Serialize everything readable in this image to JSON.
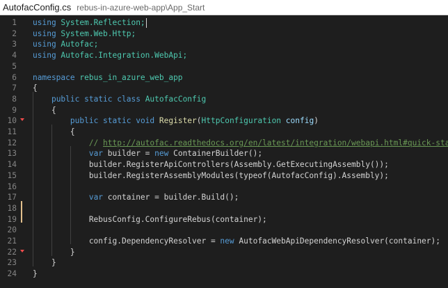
{
  "title": {
    "file": "AutofacConfig.cs",
    "path": "rebus-in-azure-web-app\\App_Start"
  },
  "lines": [
    {
      "n": "1",
      "tokens": [
        {
          "t": "using ",
          "c": "kw"
        },
        {
          "t": "System.Reflection;",
          "c": "ty"
        }
      ]
    },
    {
      "n": "2",
      "tokens": [
        {
          "t": "using ",
          "c": "kw"
        },
        {
          "t": "System.Web.Http;",
          "c": "ty"
        }
      ]
    },
    {
      "n": "3",
      "tokens": [
        {
          "t": "using ",
          "c": "kw"
        },
        {
          "t": "Autofac;",
          "c": "ty"
        }
      ]
    },
    {
      "n": "4",
      "tokens": [
        {
          "t": "using ",
          "c": "kw"
        },
        {
          "t": "Autofac.Integration.WebApi;",
          "c": "ty"
        }
      ]
    },
    {
      "n": "5",
      "tokens": []
    },
    {
      "n": "6",
      "tokens": [
        {
          "t": "namespace ",
          "c": "kw"
        },
        {
          "t": "rebus_in_azure_web_app",
          "c": "ty"
        }
      ]
    },
    {
      "n": "7",
      "tokens": [
        {
          "t": "{",
          "c": ""
        }
      ]
    },
    {
      "n": "8",
      "tokens": [
        {
          "t": "    "
        },
        {
          "t": "public ",
          "c": "kw"
        },
        {
          "t": "static ",
          "c": "kw"
        },
        {
          "t": "class ",
          "c": "kw"
        },
        {
          "t": "AutofacConfig",
          "c": "ty"
        }
      ]
    },
    {
      "n": "9",
      "tokens": [
        {
          "t": "    {"
        }
      ]
    },
    {
      "n": "10",
      "tokens": [
        {
          "t": "        "
        },
        {
          "t": "public ",
          "c": "kw"
        },
        {
          "t": "static ",
          "c": "kw"
        },
        {
          "t": "void ",
          "c": "kw"
        },
        {
          "t": "Register",
          "c": "fn"
        },
        {
          "t": "("
        },
        {
          "t": "HttpConfiguration ",
          "c": "ty"
        },
        {
          "t": "config",
          "c": "pr"
        },
        {
          "t": ")"
        }
      ]
    },
    {
      "n": "11",
      "tokens": [
        {
          "t": "        {"
        }
      ]
    },
    {
      "n": "12",
      "tokens": [
        {
          "t": "            "
        },
        {
          "t": "// ",
          "c": "cm"
        },
        {
          "t": "http://autofac.readthedocs.org/en/latest/integration/webapi.html#quick-start",
          "c": "url"
        }
      ]
    },
    {
      "n": "13",
      "tokens": [
        {
          "t": "            "
        },
        {
          "t": "var ",
          "c": "kw"
        },
        {
          "t": "builder = "
        },
        {
          "t": "new ",
          "c": "kw"
        },
        {
          "t": "ContainerBuilder();"
        }
      ]
    },
    {
      "n": "14",
      "tokens": [
        {
          "t": "            builder.RegisterApiControllers(Assembly.GetExecutingAssembly());"
        }
      ]
    },
    {
      "n": "15",
      "tokens": [
        {
          "t": "            builder.RegisterAssemblyModules(typeof(AutofacConfig).Assembly);"
        }
      ]
    },
    {
      "n": "16",
      "tokens": []
    },
    {
      "n": "17",
      "tokens": [
        {
          "t": "            "
        },
        {
          "t": "var ",
          "c": "kw"
        },
        {
          "t": "container = builder.Build();"
        }
      ]
    },
    {
      "n": "18",
      "tokens": []
    },
    {
      "n": "19",
      "tokens": [
        {
          "t": "            RebusConfig.ConfigureRebus(container);"
        }
      ]
    },
    {
      "n": "20",
      "tokens": []
    },
    {
      "n": "21",
      "tokens": [
        {
          "t": "            config.DependencyResolver = "
        },
        {
          "t": "new ",
          "c": "kw"
        },
        {
          "t": "AutofacWebApiDependencyResolver(container);"
        }
      ]
    },
    {
      "n": "22",
      "tokens": [
        {
          "t": "        }"
        }
      ]
    },
    {
      "n": "23",
      "tokens": [
        {
          "t": "    }"
        }
      ]
    },
    {
      "n": "24",
      "tokens": [
        {
          "t": "}"
        }
      ]
    }
  ]
}
